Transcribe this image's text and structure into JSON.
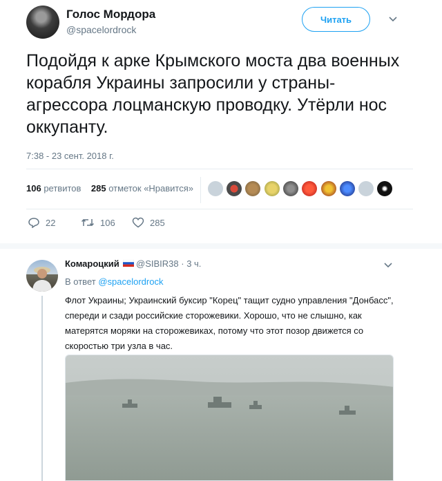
{
  "tweet": {
    "author_name": "Голос Мордора",
    "author_handle": "@spacelordrock",
    "follow_label": "Читать",
    "text": "Подойдя к арке Крымского моста два военных корабля Украины запросили у страны-агрессора лоцманскую проводку. Утёрли нос оккупанту.",
    "timestamp": "7:38 - 23 сент. 2018 г.",
    "retweet_count": "106",
    "retweet_label": "ретвитов",
    "like_count": "285",
    "like_label": "отметок «Нравится»",
    "actions": {
      "replies": "22",
      "retweets": "106",
      "likes": "285"
    }
  },
  "reply": {
    "author_name": "Комароцкий",
    "author_handle": "@SIBIR38",
    "time": "· 3 ч.",
    "in_reply_prefix": "В ответ",
    "in_reply_handle": "@spacelordrock",
    "text": "Флот Украины; Украинский буксир \"Корец\" тащит судно управления \"Донбасс\", спереди и сзади российские сторожевики. Хорошо, что не слышно, как матерятся моряки на сторожевиках, потому что этот позор движется со скоростью три узла в час."
  },
  "colors": {
    "accent": "#1da1f2",
    "secondary_text": "#657786",
    "divider": "#e6ecf0"
  }
}
